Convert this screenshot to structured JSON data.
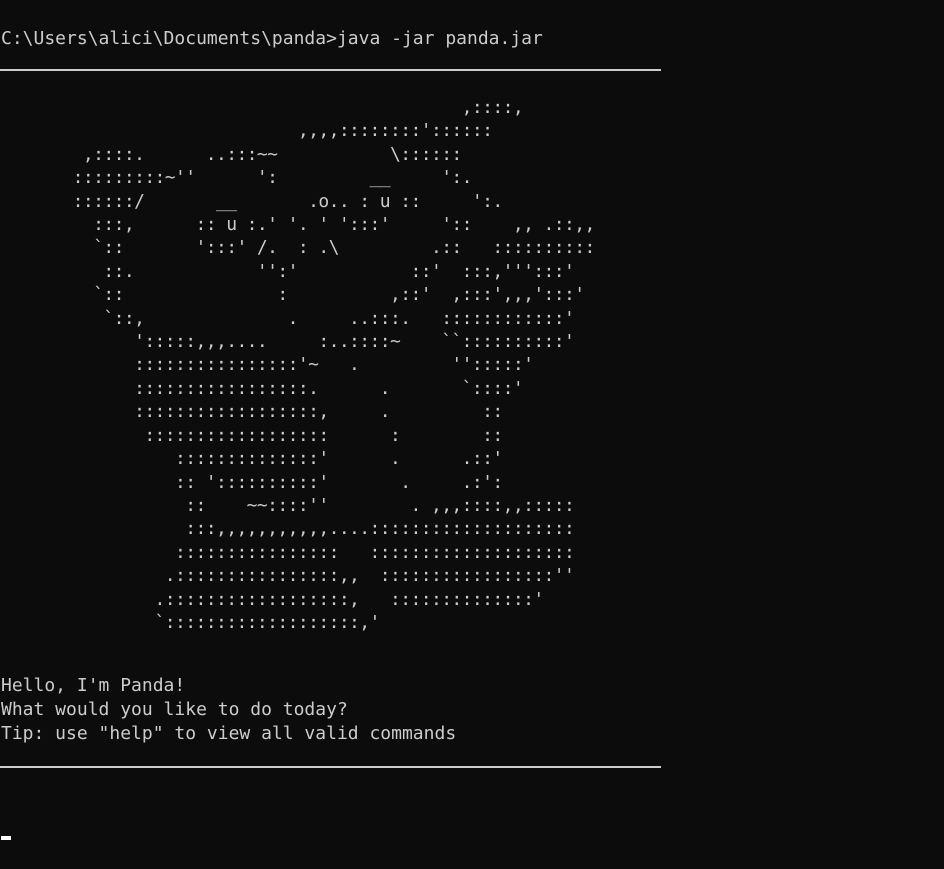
{
  "terminal": {
    "prompt": "C:\\Users\\alici\\Documents\\panda>",
    "command": "java -jar panda.jar",
    "ascii_art": "                                             ,::::,\n                             ,,,,::::::::'::::::\n        ,::::.      ..:::~~           \\::::::\n       :::::::::~''      ':         __     ':.\n       ::::::/       __       .o.. : u ::     ':.\n         :::,      :: u :.' '. ' ':::'     '::    ,, .::,,\n         `::       ':::' /.  : .\\         .::   ::::::::::\n          ::.            '':'           ::'  :::,''':::'\n         `::               :          ,::'  ,:::',,,':::'\n          `::,              .     ..:::.   ::::::::::::'\n             ':::::,,,....     :..::::~    ``::::::::::'\n             ::::::::::::::::'~   .         '':::::'\n             :::::::::::::::::.      .       `::::'\n             ::::::::::::::::::,     .         ::\n              ::::::::::::::::::      :        ::\n                 ::::::::::::::'      .      .::'\n                 :: '::::::::::'       .     .:':\n                  ::    ~~::::''        . ,,,::::,,:::::\n                  :::,,,,,,,,,,,....::::::::::::::::::::\n                 ::::::::::::::::   ::::::::::::::::::::\n                .::::::::::::::::,,  :::::::::::::::::''\n               .::::::::::::::::::,   ::::::::::::::'\n               `:::::::::::::::::::,'",
    "greeting_lines": [
      "Hello, I'm Panda!",
      "What would you like to do today?",
      "Tip: use \"help\" to view all valid commands"
    ],
    "colors": {
      "background": "#0c0c0c",
      "foreground": "#cccccc",
      "cursor": "#ffffff"
    }
  }
}
